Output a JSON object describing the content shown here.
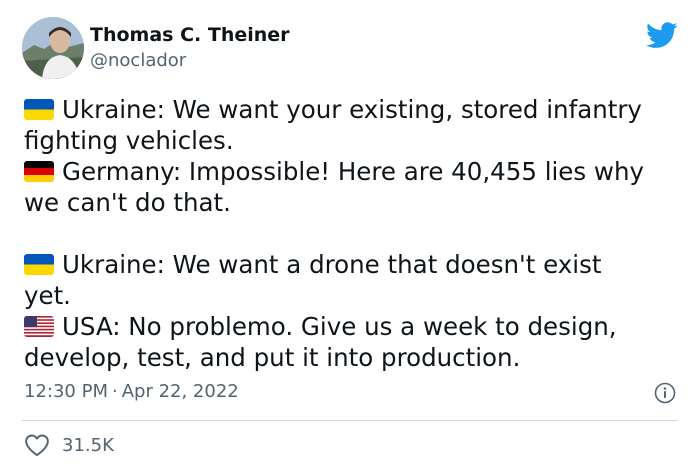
{
  "user": {
    "display_name": "Thomas C. Theiner",
    "handle": "@noclador"
  },
  "brand": {
    "icon": "twitter-bird-icon",
    "color": "#1d9bf0"
  },
  "tweet": {
    "lines": [
      "Ukraine: We want your existing, stored infantry",
      "fighting vehicles.",
      "Germany: Impossible! Here are 40,455 lies why",
      "we can't do that.",
      "Ukraine: We want a drone that doesn't exist",
      "yet.",
      "USA: No problemo. Give us a week to design,",
      "develop, test, and put it into production."
    ],
    "flags": [
      "ukraine-flag-icon",
      "germany-flag-icon",
      "ukraine-flag-icon",
      "usa-flag-icon"
    ]
  },
  "meta": {
    "time": "12:30 PM",
    "separator": "·",
    "date": "Apr 22, 2022"
  },
  "stats": {
    "likes": "31.5K"
  },
  "colors": {
    "text": "#0f1419",
    "muted": "#536471",
    "divider": "#cfd9de"
  }
}
